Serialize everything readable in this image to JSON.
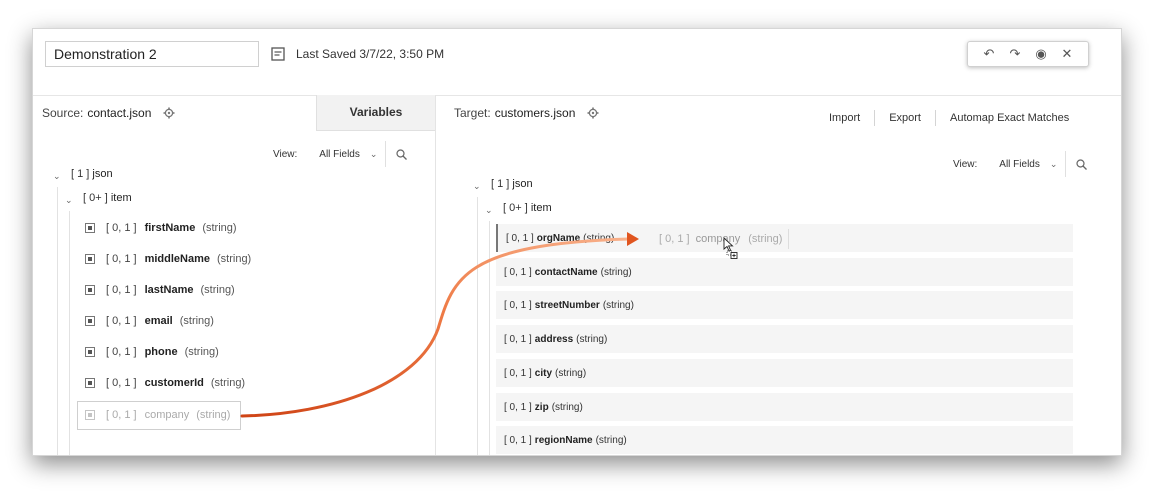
{
  "header": {
    "title": "Demonstration 2",
    "last_saved": "Last Saved 3/7/22, 3:50 PM",
    "toolbar": {
      "undo": "↶",
      "redo": "↷",
      "preview": "◉",
      "close": "✕"
    }
  },
  "source": {
    "label": "Source:",
    "file": "contact.json",
    "variables_tab": "Variables",
    "view_label": "View:",
    "view_value": "All Fields",
    "root": {
      "card": "[ 1 ]",
      "name": "json"
    },
    "item": {
      "card": "[ 0+ ]",
      "name": "item"
    },
    "fields": [
      {
        "card": "[ 0, 1 ]",
        "name": "firstName",
        "type": "(string)"
      },
      {
        "card": "[ 0, 1 ]",
        "name": "middleName",
        "type": "(string)"
      },
      {
        "card": "[ 0, 1 ]",
        "name": "lastName",
        "type": "(string)"
      },
      {
        "card": "[ 0, 1 ]",
        "name": "email",
        "type": "(string)"
      },
      {
        "card": "[ 0, 1 ]",
        "name": "phone",
        "type": "(string)"
      },
      {
        "card": "[ 0, 1 ]",
        "name": "customerId",
        "type": "(string)"
      },
      {
        "card": "[ 0, 1 ]",
        "name": "company",
        "type": "(string)"
      }
    ]
  },
  "target": {
    "label": "Target:",
    "file": "customers.json",
    "actions": {
      "import": "Import",
      "export": "Export",
      "automap": "Automap Exact Matches"
    },
    "view_label": "View:",
    "view_value": "All Fields",
    "root": {
      "card": "[ 1 ]",
      "name": "json"
    },
    "item": {
      "card": "[ 0+ ]",
      "name": "item"
    },
    "fields": [
      {
        "card": "[ 0, 1 ]",
        "name": "orgName",
        "type": "(string)"
      },
      {
        "card": "[ 0, 1 ]",
        "name": "contactName",
        "type": "(string)"
      },
      {
        "card": "[ 0, 1 ]",
        "name": "streetNumber",
        "type": "(string)"
      },
      {
        "card": "[ 0, 1 ]",
        "name": "address",
        "type": "(string)"
      },
      {
        "card": "[ 0, 1 ]",
        "name": "city",
        "type": "(string)"
      },
      {
        "card": "[ 0, 1 ]",
        "name": "zip",
        "type": "(string)"
      },
      {
        "card": "[ 0, 1 ]",
        "name": "regionName",
        "type": "(string)"
      }
    ],
    "drag_ghost": {
      "card": "[ 0, 1 ]",
      "name": "company",
      "type": "(string)"
    }
  },
  "colors": {
    "arrow_start": "#f7a36b",
    "arrow_end": "#d4481a",
    "row_bg": "#f5f5f5"
  }
}
